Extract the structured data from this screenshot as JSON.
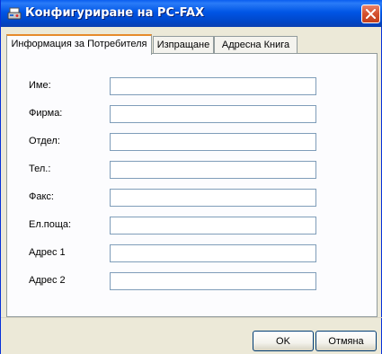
{
  "window": {
    "title": "Конфигуриране на PC-FAX",
    "title_icon": "fax-app-icon",
    "close_icon": "close-icon",
    "accent_colors": {
      "titlebar": "#0055e5",
      "close_button": "#d4502e",
      "active_tab_highlight": "#e68b2c"
    }
  },
  "tabs": [
    {
      "label": "Информация за Потребителя",
      "active": true
    },
    {
      "label": "Изпращане",
      "active": false
    },
    {
      "label": "Адресна Книга",
      "active": false
    }
  ],
  "fields": [
    {
      "label": "Име:",
      "value": ""
    },
    {
      "label": "Фирма:",
      "value": ""
    },
    {
      "label": "Отдел:",
      "value": ""
    },
    {
      "label": "Тел.:",
      "value": ""
    },
    {
      "label": "Факс:",
      "value": ""
    },
    {
      "label": "Ел.поща:",
      "value": ""
    },
    {
      "label": "Адрес 1",
      "value": ""
    },
    {
      "label": "Адрес 2",
      "value": ""
    }
  ],
  "buttons": {
    "ok_label": "OK",
    "cancel_label": "Отмяна"
  }
}
